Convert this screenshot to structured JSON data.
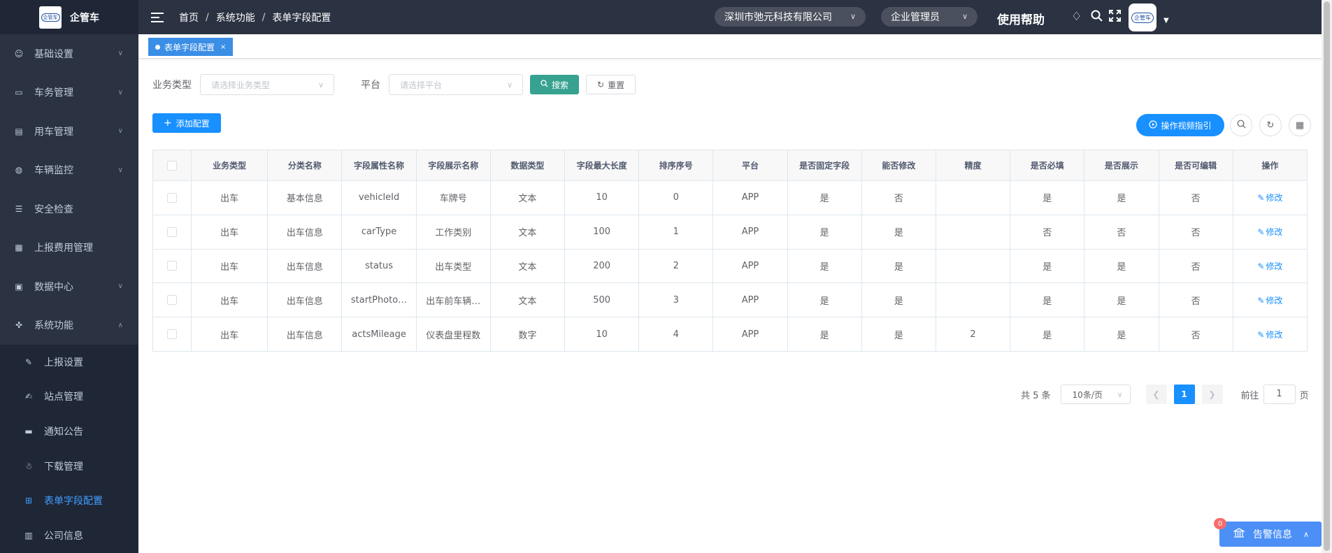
{
  "app": {
    "name": "企管车",
    "logo_text": "企管车"
  },
  "sidebar": {
    "items": [
      {
        "label": "基础设置",
        "icon": "user-icon",
        "glyph": "☺",
        "expandable": true
      },
      {
        "label": "车务管理",
        "icon": "monitor-icon",
        "glyph": "▭",
        "expandable": true
      },
      {
        "label": "用车管理",
        "icon": "car-doc-icon",
        "glyph": "▤",
        "expandable": true
      },
      {
        "label": "车辆监控",
        "icon": "globe-icon",
        "glyph": "◍",
        "expandable": true
      },
      {
        "label": "安全检查",
        "icon": "checklist-icon",
        "glyph": "☰",
        "expandable": false
      },
      {
        "label": "上报费用管理",
        "icon": "grid-icon",
        "glyph": "▦",
        "expandable": false
      },
      {
        "label": "数据中心",
        "icon": "lock-icon",
        "glyph": "▣",
        "expandable": true
      },
      {
        "label": "系统功能",
        "icon": "move-icon",
        "glyph": "✜",
        "expandable": true
      }
    ],
    "submenu": [
      {
        "label": "上报设置",
        "icon": "edit-doc-icon",
        "glyph": "✎"
      },
      {
        "label": "站点管理",
        "icon": "edit-icon",
        "glyph": "✍"
      },
      {
        "label": "通知公告",
        "icon": "message-icon",
        "glyph": "▬"
      },
      {
        "label": "下载管理",
        "icon": "group-icon",
        "glyph": "☃"
      },
      {
        "label": "表单字段配置",
        "icon": "table-icon",
        "glyph": "⊞",
        "active": true
      },
      {
        "label": "公司信息",
        "icon": "file-icon",
        "glyph": "▥"
      }
    ]
  },
  "header": {
    "breadcrumb": [
      "首页",
      "系统功能",
      "表单字段配置"
    ],
    "company": "深圳市弛元科技有限公司",
    "role": "企业管理员",
    "help": "使用帮助"
  },
  "tags": {
    "active": "表单字段配置",
    "close": "×"
  },
  "filters": {
    "business_type_label": "业务类型",
    "business_type_placeholder": "请选择业务类型",
    "platform_label": "平台",
    "platform_placeholder": "请选择平台",
    "search": "搜索",
    "reset": "重置"
  },
  "toolbar": {
    "add": "添加配置",
    "video_guide": "操作视频指引"
  },
  "table": {
    "columns": [
      "业务类型",
      "分类名称",
      "字段属性名称",
      "字段展示名称",
      "数据类型",
      "字段最大长度",
      "排序序号",
      "平台",
      "是否固定字段",
      "能否修改",
      "精度",
      "是否必填",
      "是否展示",
      "是否可编辑",
      "操作"
    ],
    "action_label": "修改",
    "rows": [
      [
        "出车",
        "基本信息",
        "vehicleId",
        "车牌号",
        "文本",
        "10",
        "0",
        "APP",
        "是",
        "否",
        "",
        "是",
        "是",
        "否"
      ],
      [
        "出车",
        "出车信息",
        "carType",
        "工作类别",
        "文本",
        "100",
        "1",
        "APP",
        "是",
        "是",
        "",
        "否",
        "否",
        "否"
      ],
      [
        "出车",
        "出车信息",
        "status",
        "出车类型",
        "文本",
        "200",
        "2",
        "APP",
        "是",
        "是",
        "",
        "是",
        "是",
        "否"
      ],
      [
        "出车",
        "出车信息",
        "startPhoto…",
        "出车前车辆…",
        "文本",
        "500",
        "3",
        "APP",
        "是",
        "是",
        "",
        "是",
        "是",
        "否"
      ],
      [
        "出车",
        "出车信息",
        "actsMileage",
        "仪表盘里程数",
        "数字",
        "10",
        "4",
        "APP",
        "是",
        "是",
        "2",
        "是",
        "是",
        "否"
      ]
    ]
  },
  "pagination": {
    "total": "共 5 条",
    "page_size": "10条/页",
    "current": "1",
    "goto_prefix": "前往",
    "goto_value": "1",
    "goto_suffix": "页"
  },
  "alert": {
    "label": "告警信息",
    "count": "0"
  },
  "colors": {
    "sidebar_bg": "#2b3242",
    "primary": "#1890ff",
    "search_btn": "#36a28f",
    "active_menu": "#409eff"
  }
}
